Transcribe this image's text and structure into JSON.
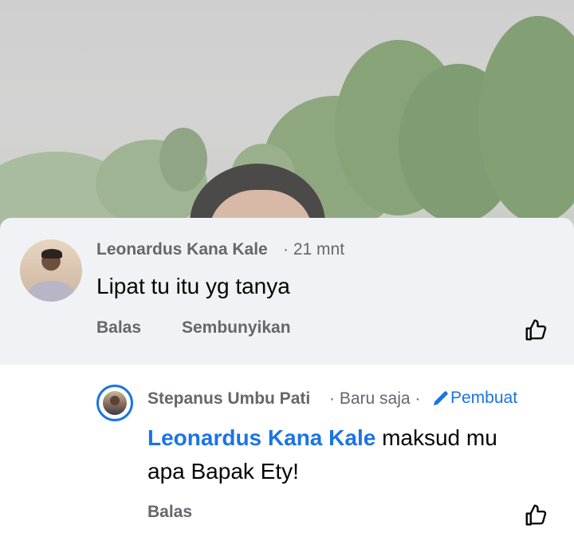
{
  "comments": [
    {
      "author": "Leonardus Kana Kale",
      "time": "· 21 mnt",
      "text": "Lipat tu itu yg tanya",
      "actions": {
        "reply": "Balas",
        "hide": "Sembunyikan"
      }
    },
    {
      "author": "Stepanus Umbu Pati",
      "time": "· Baru saja ·",
      "author_badge": "Pembuat",
      "mention": "Leonardus Kana Kale",
      "text_after_mention": " maksud mu",
      "text_line2": "apa Bapak Ety!",
      "actions": {
        "reply": "Balas"
      }
    }
  ],
  "icons": {
    "like": "thumbs-up-icon",
    "pencil": "pencil-icon"
  },
  "colors": {
    "accent": "#1b74e4",
    "secondary_text": "#65676b",
    "comment_bg": "#f0f2f5"
  }
}
